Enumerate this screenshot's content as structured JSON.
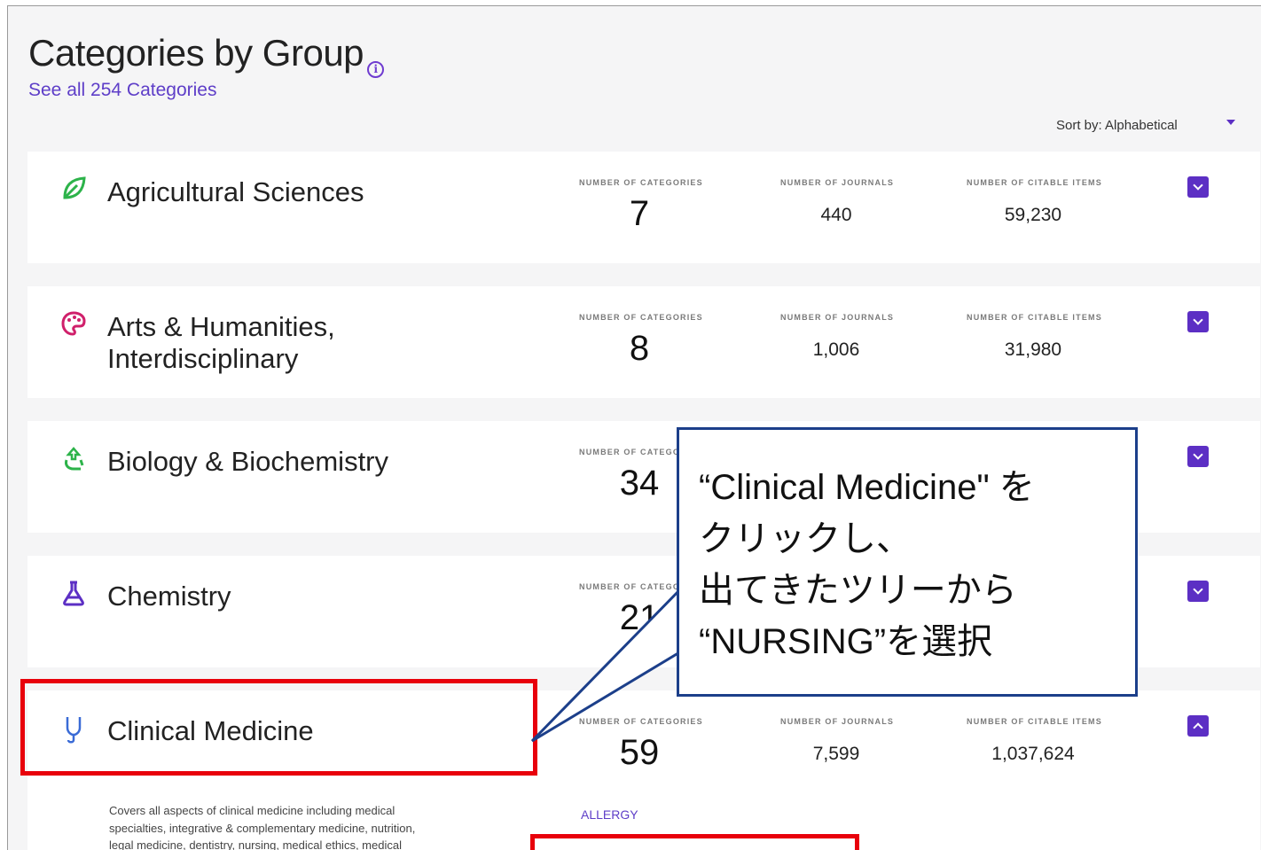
{
  "header": {
    "title": "Categories by Group",
    "see_all": "See all 254 Categories",
    "sort_label": "Sort by: Alphabetical"
  },
  "stat_labels": {
    "categories": "Number of categories",
    "journals": "Number of journals",
    "citable": "Number of citable items"
  },
  "groups": [
    {
      "name": "Agricultural Sciences",
      "icon": "leaf-icon",
      "color": "#2db34a",
      "categories": "7",
      "journals": "440",
      "citable": "59,230"
    },
    {
      "name_line1": "Arts & Humanities,",
      "name_line2": "Interdisciplinary",
      "icon": "palette-icon",
      "color": "#d0206b",
      "categories": "8",
      "journals": "1,006",
      "citable": "31,980"
    },
    {
      "name": "Biology & Biochemistry",
      "icon": "recycle-icon",
      "color": "#2db34a",
      "categories": "34"
    },
    {
      "name": "Chemistry",
      "icon": "flask-icon",
      "color": "#5c2fc4",
      "categories": "21"
    },
    {
      "name": "Clinical Medicine",
      "icon": "stethoscope-icon",
      "color": "#3a6bd6",
      "categories": "59",
      "journals": "7,599",
      "citable": "1,037,624"
    }
  ],
  "clinical_medicine": {
    "description_lines": [
      "Covers all aspects of clinical medicine including medical",
      "specialties, integrative & complementary medicine, nutrition,",
      "legal medicine, dentistry, nursing, medical ethics, medical"
    ],
    "first_subcategory": "ALLERGY"
  },
  "callout": {
    "line1": "“Clinical Medicine\" を",
    "line2": "クリックし、",
    "line3": "出てきたツリーから",
    "line4": "“NURSING”を選択"
  },
  "colors": {
    "accent": "#5c2fc4",
    "highlight": "#e8000b",
    "callout_border": "#1c3f8a"
  }
}
